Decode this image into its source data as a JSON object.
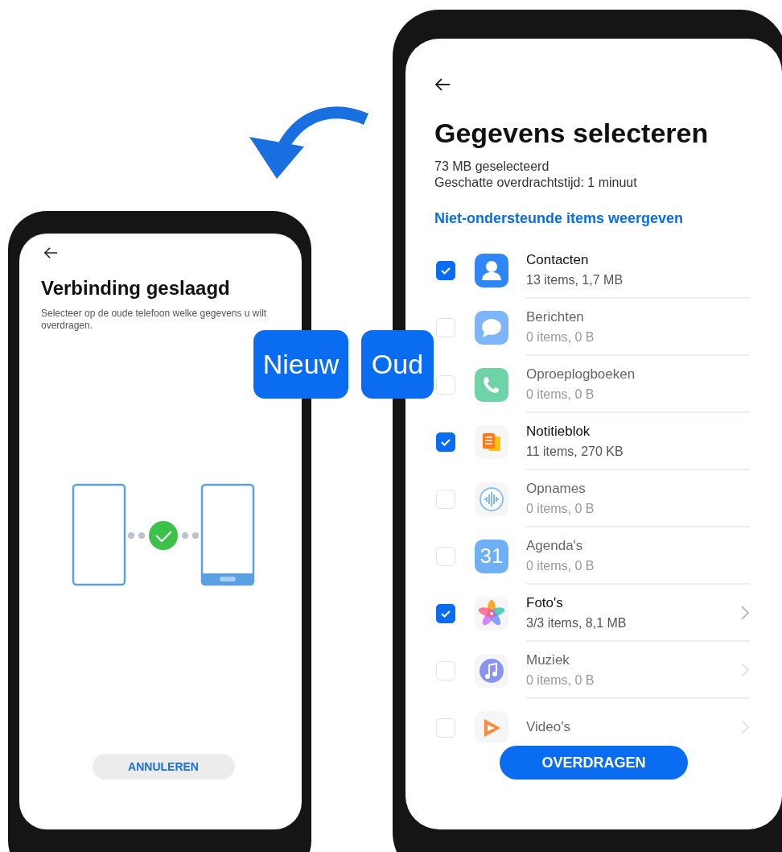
{
  "new_phone": {
    "title": "Verbinding geslaagd",
    "description": "Selecteer op de oude telefoon welke gegevens u wilt overdragen.",
    "connected": true,
    "cancel_button": "ANNULEREN"
  },
  "labels": {
    "new": "Nieuw",
    "old": "Oud"
  },
  "old_phone": {
    "title": "Gegevens selecteren",
    "selected_size": "73 MB geselecteerd",
    "estimated_time": "Geschatte overdrachtstijd: 1 minuut",
    "link": "Niet-ondersteunde items weergeven",
    "items": [
      {
        "kind": "contacts",
        "name": "Contacten",
        "detail": "13 items, 1,7 MB",
        "checked": true,
        "has_details": false
      },
      {
        "kind": "messages",
        "name": "Berichten",
        "detail": "0 items, 0 B",
        "checked": false,
        "has_details": false
      },
      {
        "kind": "calls",
        "name": "Oproeplogboeken",
        "detail": "0 items, 0 B",
        "checked": false,
        "has_details": false
      },
      {
        "kind": "notes",
        "name": "Notitieblok",
        "detail": "11 items, 270 KB",
        "checked": true,
        "has_details": false
      },
      {
        "kind": "recordings",
        "name": "Opnames",
        "detail": "0 items, 0 B",
        "checked": false,
        "has_details": false
      },
      {
        "kind": "calendar",
        "name": "Agenda's",
        "detail": "0 items, 0 B",
        "checked": false,
        "has_details": false,
        "icon_label": "31"
      },
      {
        "kind": "photos",
        "name": "Foto's",
        "detail": "3/3 items, 8,1 MB",
        "checked": true,
        "has_details": true
      },
      {
        "kind": "music",
        "name": "Muziek",
        "detail": "0 items, 0 B",
        "checked": false,
        "has_details": true
      },
      {
        "kind": "videos",
        "name": "Video's",
        "checked": false,
        "has_details": true
      }
    ],
    "transfer_button": "OVERDRAGEN"
  }
}
